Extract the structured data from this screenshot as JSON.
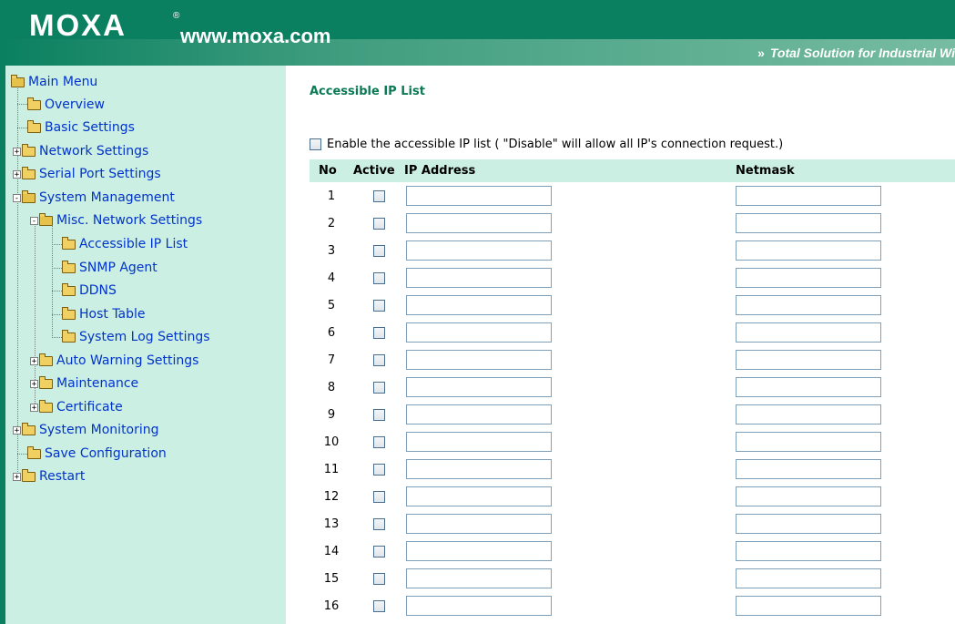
{
  "header": {
    "logo": "MOXA",
    "registered_mark": "®",
    "url": "www.moxa.com",
    "tagline_arrows": "»",
    "tagline": "Total Solution for Industrial Wi",
    "colors": {
      "band": "#0a8060",
      "sidebar_bg": "#ccefe3",
      "title": "#0a7a55",
      "link": "#0033cc"
    }
  },
  "sidebar": {
    "items": [
      {
        "label": "Main Menu",
        "icon": "folder-open-icon"
      },
      {
        "label": "Overview",
        "icon": "folder-icon"
      },
      {
        "label": "Basic Settings",
        "icon": "folder-icon"
      },
      {
        "label": "Network Settings",
        "icon": "folder-icon",
        "expander": "+"
      },
      {
        "label": "Serial Port Settings",
        "icon": "folder-icon",
        "expander": "+"
      },
      {
        "label": "System Management",
        "icon": "folder-open-icon",
        "expander": "-"
      },
      {
        "label": "Misc. Network Settings",
        "icon": "folder-open-icon",
        "expander": "-"
      },
      {
        "label": "Accessible IP List",
        "icon": "folder-icon"
      },
      {
        "label": "SNMP Agent",
        "icon": "folder-icon"
      },
      {
        "label": "DDNS",
        "icon": "folder-icon"
      },
      {
        "label": "Host Table",
        "icon": "folder-icon"
      },
      {
        "label": "System Log Settings",
        "icon": "folder-icon"
      },
      {
        "label": "Auto Warning Settings",
        "icon": "folder-icon",
        "expander": "+"
      },
      {
        "label": "Maintenance",
        "icon": "folder-icon",
        "expander": "+"
      },
      {
        "label": "Certificate",
        "icon": "folder-icon",
        "expander": "+"
      },
      {
        "label": "System Monitoring",
        "icon": "folder-icon",
        "expander": "+"
      },
      {
        "label": "Save Configuration",
        "icon": "folder-icon"
      },
      {
        "label": "Restart",
        "icon": "folder-icon",
        "expander": "+"
      }
    ]
  },
  "main": {
    "title": "Accessible IP List",
    "enable_label": "Enable the accessible IP list ( \"Disable\" will allow all IP's connection request.)",
    "columns": {
      "no": "No",
      "active": "Active",
      "ip": "IP Address",
      "netmask": "Netmask"
    },
    "rows": [
      {
        "no": "1",
        "active": false,
        "ip": "",
        "netmask": ""
      },
      {
        "no": "2",
        "active": false,
        "ip": "",
        "netmask": ""
      },
      {
        "no": "3",
        "active": false,
        "ip": "",
        "netmask": ""
      },
      {
        "no": "4",
        "active": false,
        "ip": "",
        "netmask": ""
      },
      {
        "no": "5",
        "active": false,
        "ip": "",
        "netmask": ""
      },
      {
        "no": "6",
        "active": false,
        "ip": "",
        "netmask": ""
      },
      {
        "no": "7",
        "active": false,
        "ip": "",
        "netmask": ""
      },
      {
        "no": "8",
        "active": false,
        "ip": "",
        "netmask": ""
      },
      {
        "no": "9",
        "active": false,
        "ip": "",
        "netmask": ""
      },
      {
        "no": "10",
        "active": false,
        "ip": "",
        "netmask": ""
      },
      {
        "no": "11",
        "active": false,
        "ip": "",
        "netmask": ""
      },
      {
        "no": "12",
        "active": false,
        "ip": "",
        "netmask": ""
      },
      {
        "no": "13",
        "active": false,
        "ip": "",
        "netmask": ""
      },
      {
        "no": "14",
        "active": false,
        "ip": "",
        "netmask": ""
      },
      {
        "no": "15",
        "active": false,
        "ip": "",
        "netmask": ""
      },
      {
        "no": "16",
        "active": false,
        "ip": "",
        "netmask": ""
      }
    ]
  }
}
